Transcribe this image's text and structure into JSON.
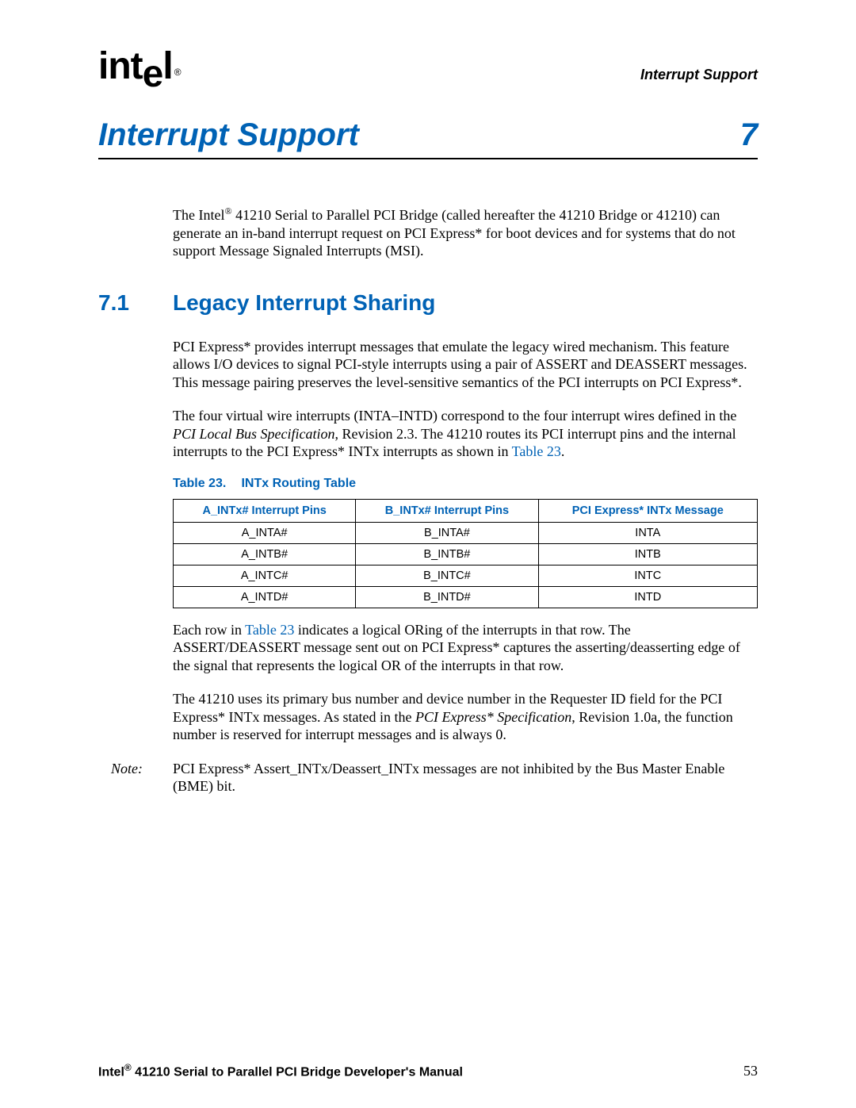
{
  "header": {
    "logo_text_a": "int",
    "logo_text_b": "e",
    "logo_text_c": "l",
    "logo_reg": "®",
    "right": "Interrupt Support"
  },
  "chapter": {
    "title": "Interrupt Support",
    "number": "7"
  },
  "intro": {
    "p1_a": "The Intel",
    "p1_reg": "®",
    "p1_b": " 41210 Serial to Parallel PCI Bridge (called hereafter the 41210 Bridge or 41210) can generate an in-band interrupt request on PCI Express* for boot devices and for systems that do not support Message Signaled Interrupts (MSI)."
  },
  "section": {
    "num": "7.1",
    "title": "Legacy Interrupt Sharing",
    "p1": "PCI Express* provides interrupt messages that emulate the legacy wired mechanism. This feature allows I/O devices to signal PCI-style interrupts using a pair of ASSERT and DEASSERT messages. This message pairing preserves the level-sensitive semantics of the PCI interrupts on PCI Express*.",
    "p2_a": "The four virtual wire interrupts (INTA–INTD) correspond to the four interrupt wires defined in the ",
    "p2_i": "PCI Local Bus Specification",
    "p2_b": ", Revision 2.3. The 41210 routes its PCI interrupt pins and the internal interrupts to the PCI Express* INTx interrupts as shown in ",
    "p2_link": "Table 23",
    "p2_c": "."
  },
  "table": {
    "caption_label": "Table 23.",
    "caption_title": "INTx Routing Table",
    "headers": [
      "A_INTx# Interrupt Pins",
      "B_INTx# Interrupt Pins",
      "PCI Express* INTx Message"
    ],
    "rows": [
      [
        "A_INTA#",
        "B_INTA#",
        "INTA"
      ],
      [
        "A_INTB#",
        "B_INTB#",
        "INTB"
      ],
      [
        "A_INTC#",
        "B_INTC#",
        "INTC"
      ],
      [
        "A_INTD#",
        "B_INTD#",
        "INTD"
      ]
    ]
  },
  "after": {
    "p1_a": "Each row in ",
    "p1_link": "Table 23",
    "p1_b": " indicates a logical ORing of the interrupts in that row. The ASSERT/DEASSERT message sent out on PCI Express* captures the asserting/deasserting edge of the signal that represents the logical OR of the interrupts in that row.",
    "p2_a": "The 41210 uses its primary bus number and device number in the Requester ID field for the PCI Express* INTx messages. As stated in the ",
    "p2_i": "PCI Express* Specification",
    "p2_b": ", Revision 1.0a, the function number is reserved for interrupt messages and is always 0."
  },
  "note": {
    "label": "Note:",
    "body": "PCI Express* Assert_INTx/Deassert_INTx messages are not inhibited by the Bus Master Enable (BME) bit."
  },
  "footer": {
    "left_a": "Intel",
    "left_reg": "®",
    "left_b": " 41210 Serial to Parallel PCI Bridge Developer's Manual",
    "page": "53"
  }
}
